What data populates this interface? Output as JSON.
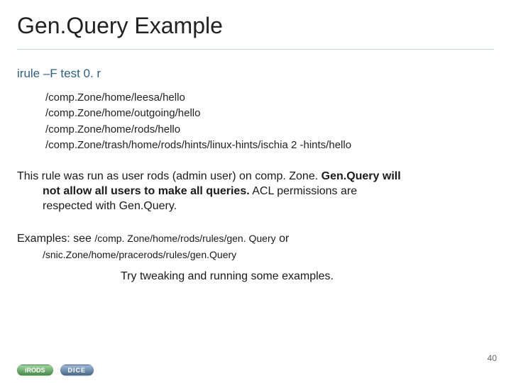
{
  "title": "Gen.Query Example",
  "command": "irule –F test 0. r",
  "outputs": [
    "/comp.Zone/home/leesa/hello",
    "/comp.Zone/home/outgoing/hello",
    "/comp.Zone/home/rods/hello",
    "/comp.Zone/trash/home/rods/hints/linux-hints/ischia 2 -hints/hello"
  ],
  "paragraph": {
    "line1_a": "This rule was run as user rods (admin user) on comp. Zone. ",
    "line1_b_bold": "Gen.Query will",
    "line2_bold": "not allow all users to make all queries.",
    "line2_rest": "  ACL permissions are",
    "line3": "respected with Gen.Query."
  },
  "examples": {
    "lead": "Examples: see ",
    "path1": "/comp. Zone/home/rods/rules/gen. Query",
    "or": " or",
    "path2": "/snic.Zone/home/pracerods/rules/gen.Query"
  },
  "tweak": "Try tweaking and running some examples.",
  "slide_number": "40",
  "badges": {
    "irods": "iRODS",
    "dice": "DICE"
  }
}
